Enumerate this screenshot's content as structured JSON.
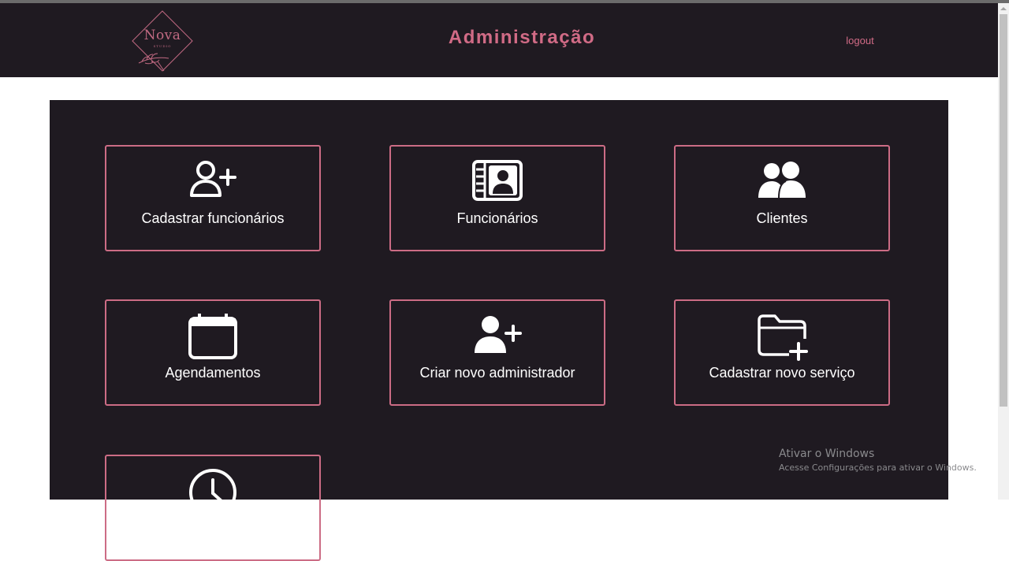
{
  "header": {
    "logo_text": "Nova",
    "logo_subtext": "STUDIO",
    "title": "Administração",
    "logout_label": "logout"
  },
  "cards": [
    {
      "label": "Cadastrar funcionários",
      "icon": "user-plus-icon"
    },
    {
      "label": "Funcionários",
      "icon": "id-card-icon"
    },
    {
      "label": "Clientes",
      "icon": "users-icon"
    },
    {
      "label": "Agendamentos",
      "icon": "calendar-icon"
    },
    {
      "label": "Criar novo administrador",
      "icon": "user-plus-solid-icon"
    },
    {
      "label": "Cadastrar novo serviço",
      "icon": "folder-plus-icon"
    },
    {
      "label": "",
      "icon": "clock-icon"
    }
  ],
  "watermark": {
    "title": "Ativar o Windows",
    "subtitle": "Acesse Configurações para ativar o Windows."
  },
  "colors": {
    "background_dark": "#1f1a21",
    "accent": "#d16b86",
    "card_border": "#cc6c85",
    "text": "#ffffff"
  }
}
